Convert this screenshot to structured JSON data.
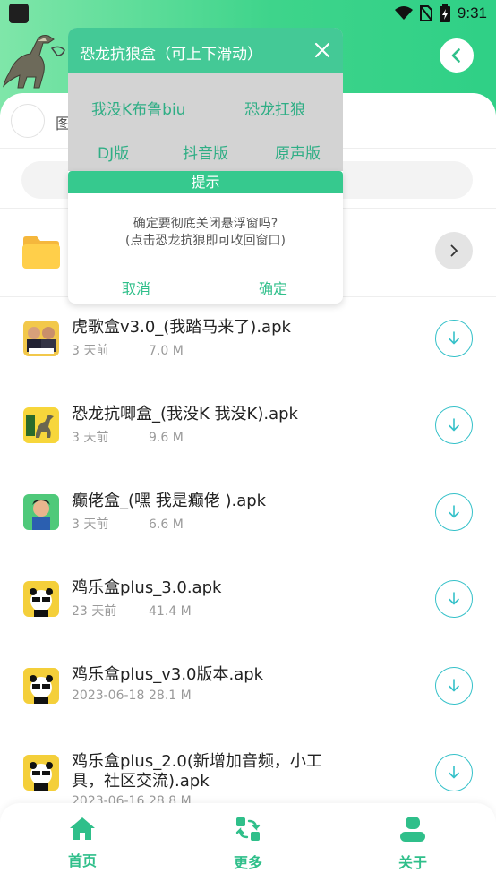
{
  "status_bar": {
    "time": "9:31"
  },
  "float_window": {
    "title": "恐龙抗狼盒（可上下滑动）",
    "options": [
      "我没K布鲁biu",
      "恐龙扛狼",
      "DJ版",
      "抖音版",
      "原声版"
    ]
  },
  "dialog": {
    "title": "提示",
    "message_line1": "确定要彻底关闭悬浮窗吗?",
    "message_line2": "(点击恐龙抗狼即可收回窗口)",
    "cancel": "取消",
    "confirm": "确定"
  },
  "profile": {
    "label": "图"
  },
  "files": [
    {
      "name": "虎歌盒v3.0_(我踏马来了).apk",
      "time": "3 天前",
      "size": "7.0 M",
      "thumb": "people"
    },
    {
      "name": "恐龙抗唧盒_(我没K 我没K).apk",
      "time": "3 天前",
      "size": "9.6 M",
      "thumb": "dinosaur"
    },
    {
      "name": "癫佬盒_(嘿 我是癫佬 ).apk",
      "time": "3 天前",
      "size": "6.6 M",
      "thumb": "man"
    },
    {
      "name": "鸡乐盒plus_3.0.apk",
      "time": "23 天前",
      "size": "41.4 M",
      "thumb": "panda"
    },
    {
      "name": "鸡乐盒plus_v3.0版本.apk",
      "time": "2023-06-18",
      "size": "28.1 M",
      "thumb": "panda"
    },
    {
      "name": "鸡乐盒plus_2.0(新增加音频，小工具，社区交流).apk",
      "time": "2023-06-16",
      "size": "28.8 M",
      "thumb": "panda"
    }
  ],
  "nav": {
    "home": "首页",
    "more": "更多",
    "about": "关于"
  },
  "colors": {
    "accent": "#2fbf8a",
    "header_green": "#3ed48b",
    "download_ring": "#35c1c9"
  },
  "icons": [
    "back-arrow-icon",
    "close-icon",
    "chevron-right-icon",
    "download-icon",
    "home-icon",
    "swap-icon",
    "user-icon",
    "wifi-icon",
    "battery-icon",
    "folder-icon"
  ]
}
